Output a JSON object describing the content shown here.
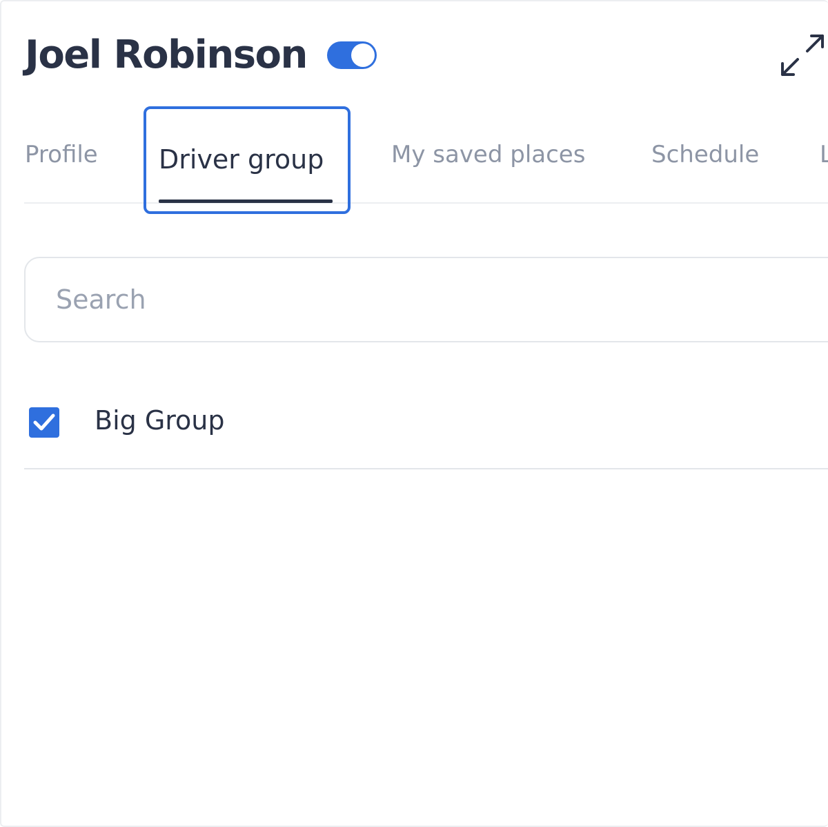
{
  "header": {
    "title": "Joel Robinson",
    "toggle_on": true,
    "expand_icon": "expand-arrows-icon"
  },
  "tabs": [
    {
      "label": "Profile",
      "active": false
    },
    {
      "label": "Driver group",
      "active": true
    },
    {
      "label": "My saved places",
      "active": false
    },
    {
      "label": "Schedule",
      "active": false
    },
    {
      "label": "L",
      "active": false
    }
  ],
  "search": {
    "value": "",
    "placeholder": "Search"
  },
  "groups": [
    {
      "label": "Big Group",
      "checked": true
    }
  ],
  "colors": {
    "accent": "#2f6fde",
    "text": "#2a3246",
    "muted": "#8d95a5",
    "border": "#e3e6ea"
  }
}
